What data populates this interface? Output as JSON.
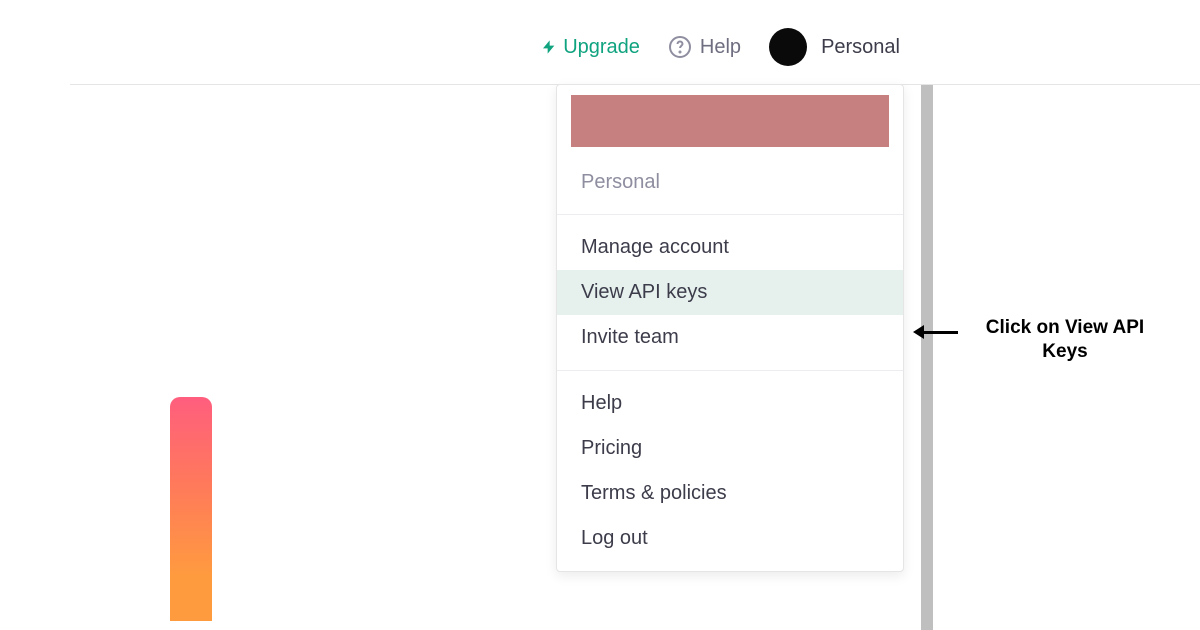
{
  "header": {
    "upgrade_label": "Upgrade",
    "help_label": "Help",
    "profile_label": "Personal"
  },
  "menu": {
    "section_label": "Personal",
    "items_group1": [
      "Manage account",
      "View API keys",
      "Invite team"
    ],
    "highlighted_index": 1,
    "items_group2": [
      "Help",
      "Pricing",
      "Terms & policies",
      "Log out"
    ]
  },
  "annotation": {
    "text": "Click on View API Keys"
  }
}
